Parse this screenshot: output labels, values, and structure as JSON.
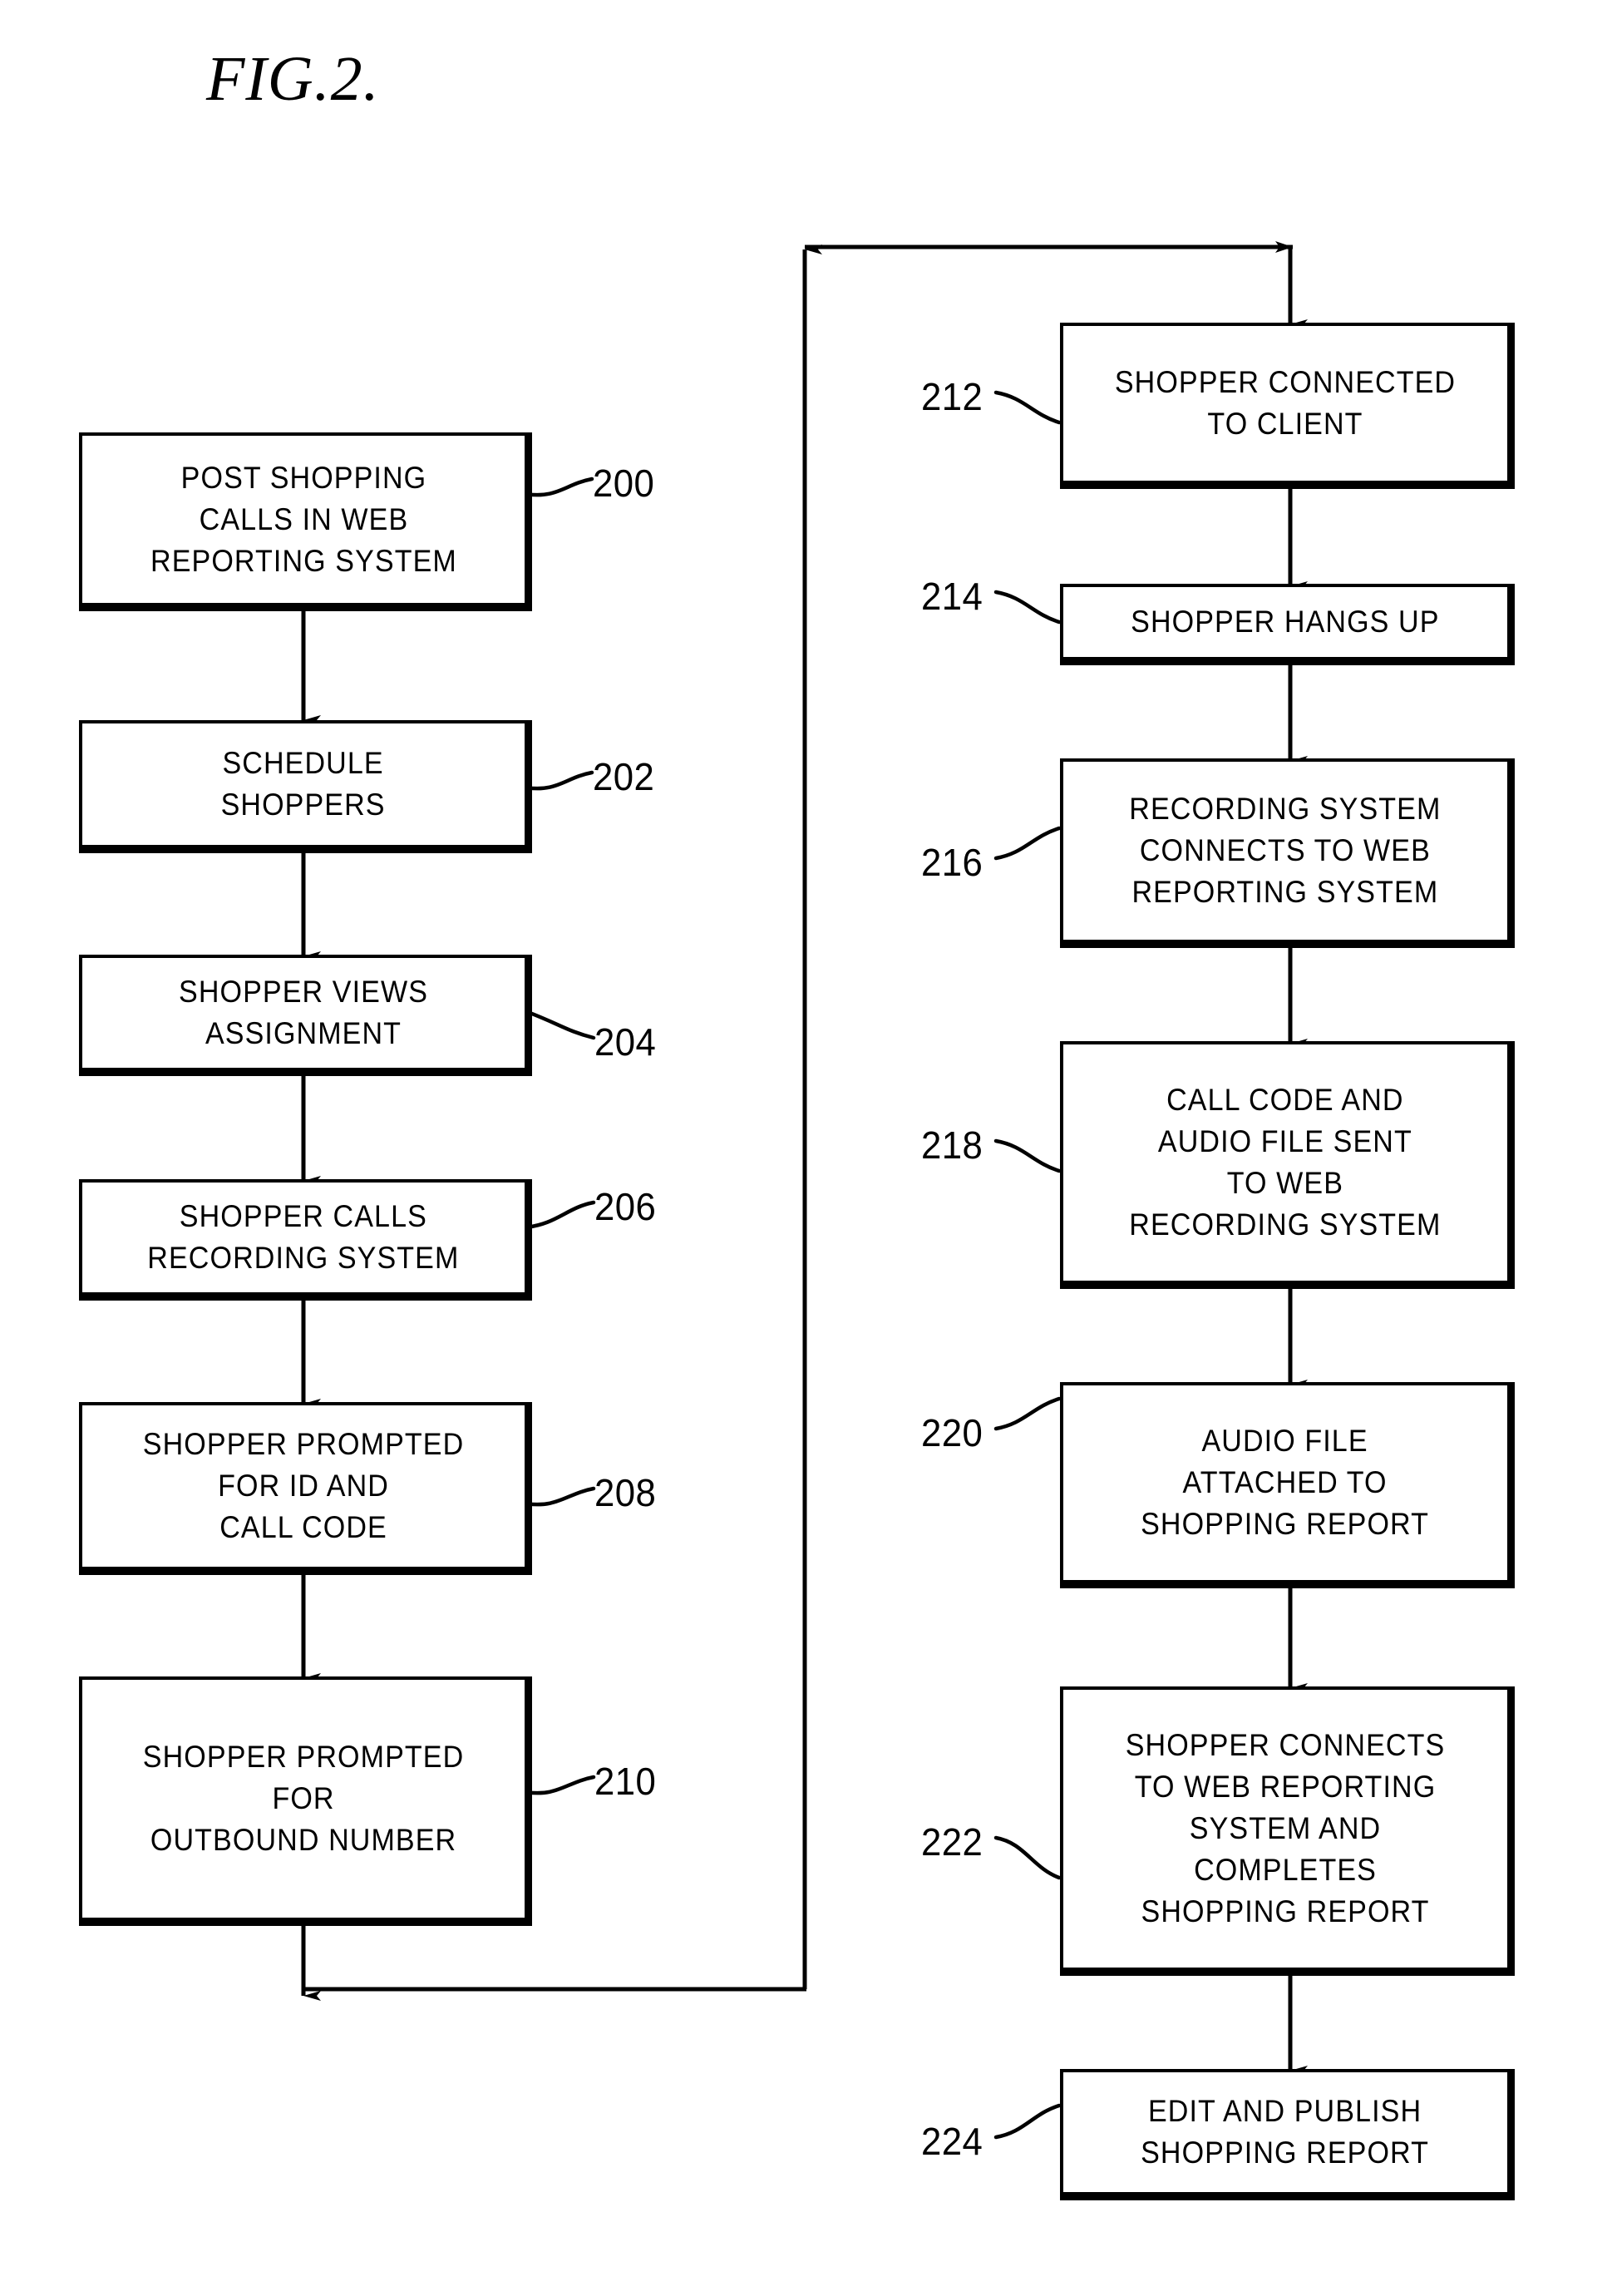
{
  "figure": {
    "title": "FIG.2.",
    "type": "patent-flowchart"
  },
  "flowchart": {
    "left_column": [
      {
        "ref": "200",
        "text": "POST SHOPPING\nCALLS IN WEB\nREPORTING SYSTEM"
      },
      {
        "ref": "202",
        "text": "SCHEDULE\nSHOPPERS"
      },
      {
        "ref": "204",
        "text": "SHOPPER VIEWS\nASSIGNMENT"
      },
      {
        "ref": "206",
        "text": "SHOPPER CALLS\nRECORDING SYSTEM"
      },
      {
        "ref": "208",
        "text": "SHOPPER PROMPTED\nFOR ID AND\nCALL CODE"
      },
      {
        "ref": "210",
        "text": "SHOPPER PROMPTED\nFOR\nOUTBOUND NUMBER"
      }
    ],
    "right_column": [
      {
        "ref": "212",
        "text": "SHOPPER CONNECTED\nTO CLIENT"
      },
      {
        "ref": "214",
        "text": "SHOPPER HANGS UP"
      },
      {
        "ref": "216",
        "text": "RECORDING SYSTEM\nCONNECTS TO WEB\nREPORTING SYSTEM"
      },
      {
        "ref": "218",
        "text": "CALL CODE AND\nAUDIO FILE SENT\nTO WEB\nRECORDING SYSTEM"
      },
      {
        "ref": "220",
        "text": "AUDIO FILE\nATTACHED TO\nSHOPPING REPORT"
      },
      {
        "ref": "222",
        "text": "SHOPPER CONNECTS\nTO WEB REPORTING\nSYSTEM AND\nCOMPLETES\nSHOPPING REPORT"
      },
      {
        "ref": "224",
        "text": "EDIT AND PUBLISH\nSHOPPING REPORT"
      }
    ]
  },
  "chart_data": {
    "type": "diagram",
    "title": "FIG.2.",
    "nodes": [
      {
        "id": "200",
        "label": "POST SHOPPING CALLS IN WEB REPORTING SYSTEM",
        "column": "left",
        "order": 1
      },
      {
        "id": "202",
        "label": "SCHEDULE SHOPPERS",
        "column": "left",
        "order": 2
      },
      {
        "id": "204",
        "label": "SHOPPER VIEWS ASSIGNMENT",
        "column": "left",
        "order": 3
      },
      {
        "id": "206",
        "label": "SHOPPER CALLS RECORDING SYSTEM",
        "column": "left",
        "order": 4
      },
      {
        "id": "208",
        "label": "SHOPPER PROMPTED FOR ID AND CALL CODE",
        "column": "left",
        "order": 5
      },
      {
        "id": "210",
        "label": "SHOPPER PROMPTED FOR OUTBOUND NUMBER",
        "column": "left",
        "order": 6
      },
      {
        "id": "212",
        "label": "SHOPPER CONNECTED TO CLIENT",
        "column": "right",
        "order": 1
      },
      {
        "id": "214",
        "label": "SHOPPER HANGS UP",
        "column": "right",
        "order": 2
      },
      {
        "id": "216",
        "label": "RECORDING SYSTEM CONNECTS TO WEB REPORTING SYSTEM",
        "column": "right",
        "order": 3
      },
      {
        "id": "218",
        "label": "CALL CODE AND AUDIO FILE SENT TO WEB RECORDING SYSTEM",
        "column": "right",
        "order": 4
      },
      {
        "id": "220",
        "label": "AUDIO FILE ATTACHED TO SHOPPING REPORT",
        "column": "right",
        "order": 5
      },
      {
        "id": "222",
        "label": "SHOPPER CONNECTS TO WEB REPORTING SYSTEM AND COMPLETES SHOPPING REPORT",
        "column": "right",
        "order": 6
      },
      {
        "id": "224",
        "label": "EDIT AND PUBLISH SHOPPING REPORT",
        "column": "right",
        "order": 7
      }
    ],
    "edges": [
      {
        "from": "200",
        "to": "202"
      },
      {
        "from": "202",
        "to": "204"
      },
      {
        "from": "204",
        "to": "206"
      },
      {
        "from": "206",
        "to": "208"
      },
      {
        "from": "208",
        "to": "210"
      },
      {
        "from": "210",
        "to": "212",
        "routing": "down-right-up-right-down"
      },
      {
        "from": "212",
        "to": "214"
      },
      {
        "from": "214",
        "to": "216"
      },
      {
        "from": "216",
        "to": "218"
      },
      {
        "from": "218",
        "to": "220"
      },
      {
        "from": "220",
        "to": "222"
      },
      {
        "from": "222",
        "to": "224"
      }
    ]
  }
}
